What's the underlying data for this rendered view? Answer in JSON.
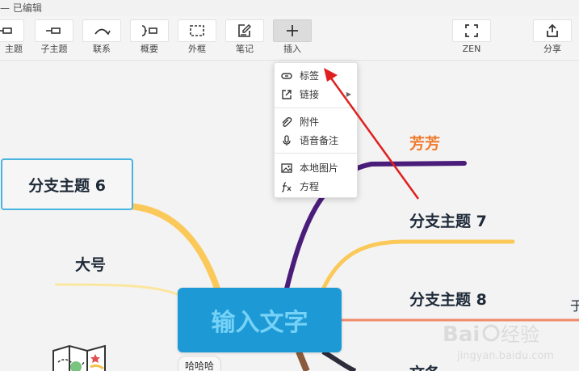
{
  "title_bar": {
    "text": "— 已编辑"
  },
  "toolbar": {
    "items": [
      {
        "label": "主题",
        "icon": "topic-icon"
      },
      {
        "label": "子主题",
        "icon": "subtopic-icon"
      },
      {
        "label": "联系",
        "icon": "relationship-icon"
      },
      {
        "label": "概要",
        "icon": "summary-icon"
      },
      {
        "label": "外框",
        "icon": "boundary-icon"
      },
      {
        "label": "笔记",
        "icon": "note-icon"
      },
      {
        "label": "插入",
        "icon": "plus-icon"
      },
      {
        "label": "ZEN",
        "icon": "zen-icon"
      },
      {
        "label": "分享",
        "icon": "share-icon"
      }
    ]
  },
  "insert_menu": {
    "items": [
      {
        "label": "标签",
        "icon": "label-icon"
      },
      {
        "label": "链接",
        "icon": "link-icon",
        "has_submenu": true
      },
      {
        "label": "附件",
        "icon": "attachment-icon"
      },
      {
        "label": "语音备注",
        "icon": "microphone-icon"
      },
      {
        "label": "本地图片",
        "icon": "image-icon"
      },
      {
        "label": "方程",
        "icon": "equation-icon"
      }
    ]
  },
  "mindmap": {
    "central_topic": "输入文字",
    "nodes": {
      "branch_6": "分支主题 6",
      "big": "大号",
      "fangfang": "芳芳",
      "branch_7": "分支主题 7",
      "branch_8": "分支主题 8",
      "partial": "文各",
      "floating": "哈哈哈",
      "edge_char": "于"
    }
  },
  "colors": {
    "central_fill": "#1d9ad6",
    "central_text": "#76d2f7",
    "branch_yellow": "#fbc95a",
    "branch_purple": "#4b1d7a",
    "branch_salmon": "#f08a6a",
    "branch_brown": "#8b5a3c",
    "fangfang_orange": "#f07a2a",
    "selection_border": "#49b4e0",
    "arrow_red": "#e02020"
  },
  "watermark": {
    "brand": "Baidu经验",
    "url": "jingyan.baidu.com"
  }
}
